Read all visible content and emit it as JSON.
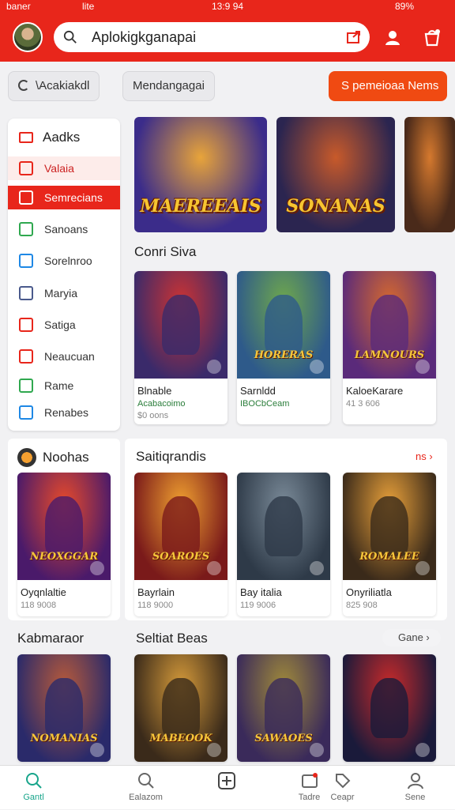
{
  "status": {
    "carrier": "baner",
    "net": "lite",
    "time": "13:9 94",
    "battery": "89%"
  },
  "header": {
    "search_text": "Aplokigkganapai"
  },
  "toolbar": {
    "btn1": "\\Acakiakdl",
    "btn2": "Mendangagai",
    "cta": "S pemeioaa Nems"
  },
  "sidebar": {
    "title": "Aadks",
    "items": [
      {
        "label": "Valaia",
        "color": "#e8261b",
        "state": "soft"
      },
      {
        "label": "Semrecians",
        "color": "#ffffff",
        "state": "active"
      },
      {
        "label": "Sanoans",
        "color": "#2fa84f",
        "state": ""
      },
      {
        "label": "Sorelnroo",
        "color": "#1e88e5",
        "state": ""
      },
      {
        "label": "Maryia",
        "color": "#4a5a8c",
        "state": ""
      },
      {
        "label": "Satiga",
        "color": "#e8261b",
        "state": ""
      },
      {
        "label": "Neaucuan",
        "color": "#e8261b",
        "state": ""
      },
      {
        "label": "Rame",
        "color": "#2fa84f",
        "state": ""
      },
      {
        "label": "Renabes",
        "color": "#1e88e5",
        "state": ""
      }
    ]
  },
  "banners": [
    {
      "title": "MAEREEAIS",
      "c1": "#3b2c8a",
      "c2": "#e8a43a"
    },
    {
      "title": "SONANAS",
      "c1": "#2b2550",
      "c2": "#c85a2a"
    },
    {
      "title": "",
      "c1": "#4a2a1a",
      "c2": "#d5792e"
    }
  ],
  "section1": {
    "title": "Conri Siva",
    "cards": [
      {
        "name": "Blnable",
        "meta": "Acabacoimo",
        "meta2": "$0 oons",
        "c1": "#3a2a6a",
        "c2": "#c33",
        "tt": ""
      },
      {
        "name": "Sarnldd",
        "meta": "IBOCbCeam",
        "meta2": "",
        "c1": "#2e5a8a",
        "c2": "#6fa84c",
        "tt": "HORERAS"
      },
      {
        "name": "KaloeKarare",
        "meta": "41 3 606",
        "meta2": "",
        "c1": "#5a2a7a",
        "c2": "#d6692e",
        "tt": "LAMNOURS"
      }
    ]
  },
  "left_panel": {
    "title": "Noohas",
    "card": {
      "name": "Oyqnlaltie",
      "meta": "118 9008",
      "c1": "#4a1a6a",
      "c2": "#e84a2a",
      "tt": "NEOXGGAR"
    }
  },
  "section2": {
    "title": "Saitiqrandis",
    "more": "ns ›",
    "cards": [
      {
        "name": "Bayrlain",
        "meta": "118 9000",
        "c1": "#7a1a1a",
        "c2": "#f0a030",
        "tt": "SOAROES"
      },
      {
        "name": "Bay italia",
        "meta": "119 9006",
        "c1": "#2e3a48",
        "c2": "#7a8a98",
        "tt": ""
      },
      {
        "name": "Onyriliatla",
        "meta": "825 908",
        "c1": "#3a2a1a",
        "c2": "#e8a03a",
        "tt": "ROMALEE"
      }
    ]
  },
  "left_panel2": {
    "title": "Kabmaraor",
    "card": {
      "c1": "#2a2a6a",
      "c2": "#b85a3a",
      "tt": "NOMANIAS"
    }
  },
  "section3": {
    "title": "Seltiat Beas",
    "pill": "Gane ›",
    "cards": [
      {
        "c1": "#3a2a1a",
        "c2": "#d59a3a",
        "tt": "MABEOOK"
      },
      {
        "c1": "#3a2a5a",
        "c2": "#a08a3a",
        "tt": "SAWAOES"
      },
      {
        "c1": "#1a1a3a",
        "c2": "#c82a2a",
        "tt": ""
      }
    ]
  },
  "tabs": [
    {
      "label": "Gantl",
      "icon": "search-icon",
      "active": true
    },
    {
      "label": "Ealazom",
      "icon": "search-icon",
      "active": false
    },
    {
      "label": "",
      "icon": "plus-icon",
      "active": false
    },
    {
      "label": "Tadre",
      "icon": "inbox-icon",
      "active": false
    },
    {
      "label": "Ceapr",
      "icon": "tag-icon",
      "active": false
    },
    {
      "label": "Sene",
      "icon": "user-icon",
      "active": false
    }
  ],
  "colors": {
    "brand": "#e8261b",
    "cta": "#f04a12",
    "tab_active": "#18a58b"
  }
}
